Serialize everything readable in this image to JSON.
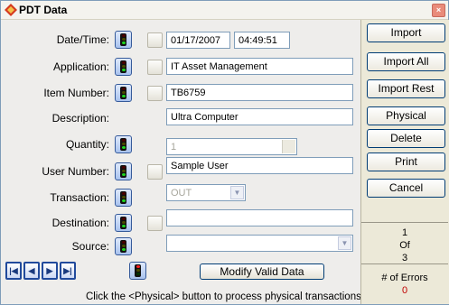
{
  "window": {
    "title": "PDT Data",
    "close_label": "×",
    "accent": "#c80000"
  },
  "form": {
    "datetime": {
      "label": "Date/Time:",
      "date": "01/17/2007",
      "time": "04:49:51"
    },
    "application": {
      "label": "Application:",
      "value": "IT Asset Management"
    },
    "item_number": {
      "label": "Item Number:",
      "value": "TB6759"
    },
    "description": {
      "label": "Description:",
      "value": "Ultra Computer"
    },
    "quantity": {
      "label": "Quantity:",
      "value": "1"
    },
    "user_number": {
      "label": "User Number:",
      "value": "Sample User"
    },
    "transaction": {
      "label": "Transaction:",
      "value": "OUT"
    },
    "destination": {
      "label": "Destination:",
      "value": ""
    },
    "source": {
      "label": "Source:",
      "value": ""
    }
  },
  "nav": {
    "first_icon": "first-record-icon",
    "prev_icon": "previous-record-icon",
    "next_icon": "next-record-icon",
    "last_icon": "last-record-icon",
    "modify_label": "Modify Valid Data"
  },
  "actions": {
    "import": "Import",
    "import_all": "Import All",
    "import_rest": "Import Rest",
    "physical": "Physical",
    "delete": "Delete",
    "print": "Print",
    "cancel": "Cancel"
  },
  "counter": {
    "current": "1",
    "of": "Of",
    "total": "3"
  },
  "errors": {
    "label": "# of Errors",
    "value": "0"
  },
  "status_text": "Click the <Physical> button to process physical transactions!"
}
